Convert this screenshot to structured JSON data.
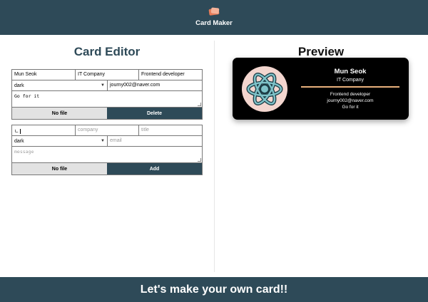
{
  "header": {
    "title": "Card Maker",
    "logo_icon": "card-maker-logo-icon"
  },
  "editor": {
    "title": "Card Editor",
    "card_form": {
      "name": "Mun Seok",
      "company": "IT Company",
      "title": "Frontend developer",
      "theme": "dark",
      "email": "journy002@naver.com",
      "message": "Go for it",
      "file_label": "No file",
      "delete_label": "Delete"
    },
    "add_form": {
      "name_value": "ㄴ",
      "company_placeholder": "company",
      "title_placeholder": "title",
      "theme": "dark",
      "email_placeholder": "email",
      "message_placeholder": "message",
      "file_label": "No file",
      "add_label": "Add"
    }
  },
  "preview": {
    "title": "Preview",
    "card": {
      "name": "Mun Seok",
      "company": "IT Company",
      "title": "Frontend developer",
      "email": "journy002@naver.com",
      "message": "Go for it",
      "theme_color": "#000000",
      "avatar_bg": "#f3d6cf",
      "rule_color": "#e8b07c"
    }
  },
  "footer": {
    "text": "Let's make your own card!!"
  },
  "colors": {
    "primary": "#2e4a58",
    "file_button": "#e2e2e2"
  }
}
